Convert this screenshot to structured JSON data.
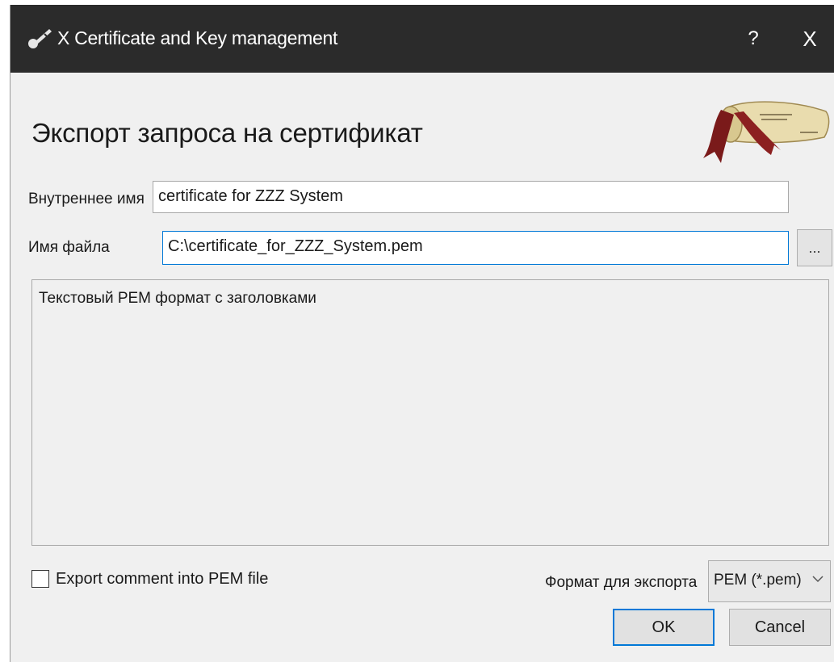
{
  "window": {
    "title": "X Certificate and Key management",
    "help_label": "?",
    "close_label": "X"
  },
  "heading": "Экспорт запроса на сертификат",
  "internal_name": {
    "label": "Внутреннее имя",
    "value": "certificate for ZZZ System"
  },
  "file_name": {
    "label": "Имя файла",
    "value": "C:\\certificate_for_ZZZ_System.pem",
    "browse_label": "..."
  },
  "description": "Текстовый PEM формат с заголовками",
  "export_comment": {
    "label": "Export comment into PEM file",
    "checked": false
  },
  "export_format": {
    "label": "Формат для экспорта",
    "selected": "PEM (*.pem)"
  },
  "buttons": {
    "ok": "OK",
    "cancel": "Cancel"
  },
  "colors": {
    "titlebar": "#2b2b2b",
    "dialog_bg": "#f0f0f0",
    "focus_accent": "#0078d7"
  },
  "icons": {
    "app": "pen-key-icon",
    "logo": "scroll-icon"
  }
}
